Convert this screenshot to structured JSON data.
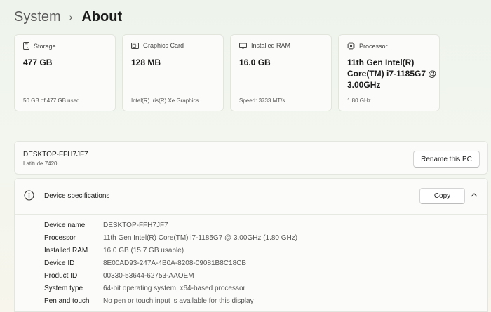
{
  "breadcrumb": {
    "parent": "System",
    "separator": "›",
    "current": "About"
  },
  "cards": {
    "storage": {
      "title": "Storage",
      "value": "477 GB",
      "sub": "50 GB of 477 GB used"
    },
    "graphics": {
      "title": "Graphics Card",
      "value": "128 MB",
      "sub": "Intel(R) Iris(R) Xe Graphics"
    },
    "ram": {
      "title": "Installed RAM",
      "value": "16.0 GB",
      "sub": "Speed: 3733 MT/s"
    },
    "processor": {
      "title": "Processor",
      "value": "11th Gen Intel(R) Core(TM) i7-1185G7 @ 3.00GHz",
      "sub": "1.80 GHz"
    }
  },
  "pc": {
    "name": "DESKTOP-FFH7JF7",
    "model": "Latitude 7420",
    "rename_label": "Rename this PC"
  },
  "specs": {
    "title": "Device specifications",
    "copy_label": "Copy",
    "rows": [
      {
        "label": "Device name",
        "value": "DESKTOP-FFH7JF7"
      },
      {
        "label": "Processor",
        "value": "11th Gen Intel(R) Core(TM) i7-1185G7 @ 3.00GHz (1.80 GHz)"
      },
      {
        "label": "Installed RAM",
        "value": "16.0 GB (15.7 GB usable)"
      },
      {
        "label": "Device ID",
        "value": "8E00AD93-247A-4B0A-8208-09081B8C18CB"
      },
      {
        "label": "Product ID",
        "value": "00330-53644-62753-AAOEM"
      },
      {
        "label": "System type",
        "value": "64-bit operating system, x64-based processor"
      },
      {
        "label": "Pen and touch",
        "value": "No pen or touch input is available for this display"
      }
    ]
  },
  "icons": {
    "storage": "storage-drive-icon",
    "graphics": "graphics-card-icon",
    "ram": "ram-chip-icon",
    "processor": "processor-chip-icon",
    "info": "info-icon",
    "collapse": "chevron-up-icon"
  }
}
